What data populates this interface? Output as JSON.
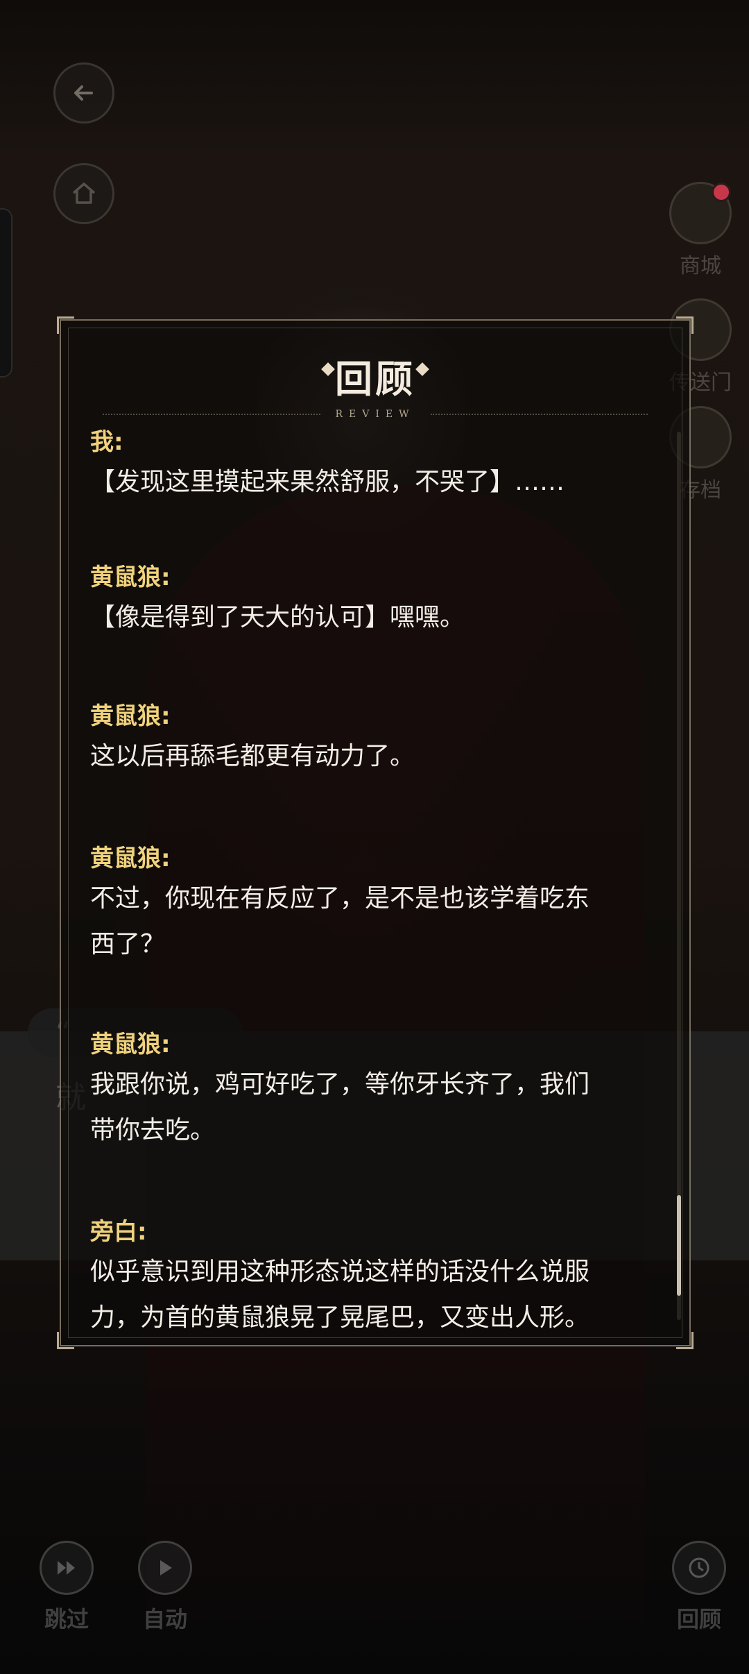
{
  "side_menu": {
    "shop_label": "商城",
    "portal_label": "传送门",
    "save_label": "存档"
  },
  "background_dialog": {
    "speaker_partial": "“",
    "text_partial": "就"
  },
  "review": {
    "title": "回顾",
    "subtitle": "REVIEW",
    "entries": [
      {
        "speaker": "我:",
        "lines": [
          "【发现这里摸起来果然舒服，不哭了】……"
        ]
      },
      {
        "speaker": "黄鼠狼:",
        "lines": [
          "【像是得到了天大的认可】嘿嘿。"
        ]
      },
      {
        "speaker": "黄鼠狼:",
        "lines": [
          "这以后再舔毛都更有动力了。"
        ]
      },
      {
        "speaker": "黄鼠狼:",
        "lines": [
          "不过，你现在有反应了，是不是也该学着吃东",
          "西了？"
        ]
      },
      {
        "speaker": "黄鼠狼:",
        "lines": [
          "我跟你说，鸡可好吃了，等你牙长齐了，我们",
          "带你去吃。"
        ]
      },
      {
        "speaker": "旁白:",
        "lines": [
          "似乎意识到用这种形态说这样的话没什么说服",
          "力，为首的黄鼠狼晃了晃尾巴，又变出人形。"
        ]
      }
    ],
    "scroll_position": 0.86
  },
  "bottom_controls": {
    "skip_label": "跳过",
    "auto_label": "自动",
    "review_label": "回顾"
  }
}
